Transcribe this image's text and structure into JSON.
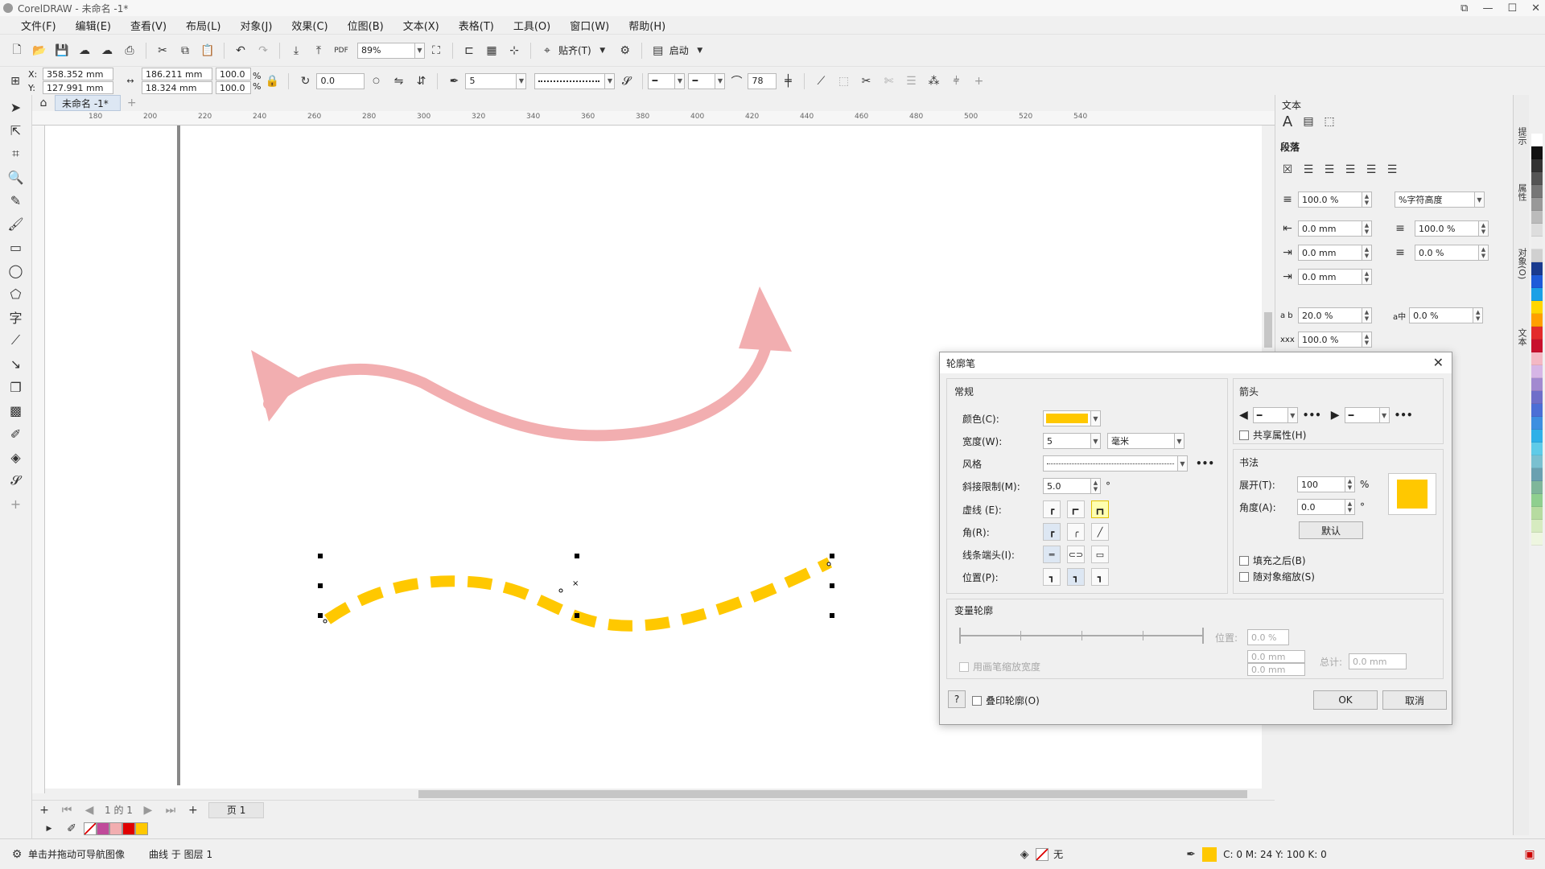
{
  "window": {
    "title": "CorelDRAW - 未命名 -1*"
  },
  "menu": [
    "文件(F)",
    "编辑(E)",
    "查看(V)",
    "布局(L)",
    "对象(J)",
    "效果(C)",
    "位图(B)",
    "文本(X)",
    "表格(T)",
    "工具(O)",
    "窗口(W)",
    "帮助(H)"
  ],
  "toolbar1": {
    "zoom": "89%",
    "snap_label": "贴齐(T)",
    "launch_label": "启动"
  },
  "toolbar2": {
    "x_label": "X:",
    "x_value": "358.352 mm",
    "y_label": "Y:",
    "y_value": "127.991 mm",
    "w_value": "186.211 mm",
    "h_value": "18.324 mm",
    "scale_w": "100.0",
    "scale_h": "100.0",
    "pct": "%",
    "rotation": "0.0",
    "outline_width": "5",
    "smooth": "78"
  },
  "doc_tab": "未命名 -1*",
  "ruler_labels": [
    "180",
    "200",
    "220",
    "240",
    "260",
    "280",
    "300",
    "320",
    "340",
    "360",
    "380",
    "400",
    "420",
    "440",
    "460",
    "480",
    "500",
    "520",
    "540"
  ],
  "pagebar": {
    "page_count": "1 的 1",
    "page_tab": "页 1"
  },
  "status": {
    "hint": "单击并拖动可导航图像",
    "layer": "曲线 于 图层 1",
    "fill_label": "无",
    "cmyk": "C: 0 M: 24 Y: 100 K: 0"
  },
  "docker": {
    "title": "文本",
    "section": "段落",
    "indent_pct": "100.0 %",
    "unit_select": "%字符高度",
    "left_indent": "0.0 mm",
    "first_indent": "0.0 mm",
    "right_indent": "0.0 mm",
    "before_pct": "100.0 %",
    "after_pct": "0.0 %",
    "char_spacing": "20.0 %",
    "lang_spacing": "0.0 %",
    "word_spacing": "100.0 %",
    "side_tabs": [
      "提示",
      "属性",
      "对象(O)",
      "文本"
    ]
  },
  "dialog": {
    "title": "轮廓笔",
    "general": "常规",
    "color_label": "颜色(C):",
    "width_label": "宽度(W):",
    "width_value": "5",
    "unit": "毫米",
    "style_label": "风格",
    "miter_label": "斜接限制(M):",
    "miter_value": "5.0",
    "degree": "°",
    "dash_label": "虚线 (E):",
    "corner_label": "角(R):",
    "cap_label": "线条端头(I):",
    "position_label": "位置(P):",
    "arrows": "箭头",
    "share_attr": "共享属性(H)",
    "calligraphy": "书法",
    "stretch_label": "展开(T):",
    "stretch_value": "100",
    "stretch_unit": "%",
    "angle_label": "角度(A):",
    "angle_value": "0.0",
    "angle_unit": "°",
    "default_btn": "默认",
    "fill_behind": "填充之后(B)",
    "scale_with": "随对象缩放(S)",
    "variable": "变量轮廓",
    "var_position_label": "位置:",
    "var_position": "0.0 %",
    "var_w1": "0.0 mm",
    "var_w2": "0.0 mm",
    "var_total_label": "总计:",
    "var_total": "0.0 mm",
    "var_scale_check": "用画笔缩放宽度",
    "help_btn": "?",
    "overprint": "叠印轮廓(O)",
    "ok": "OK",
    "cancel": "取消"
  },
  "colors": {
    "accent_yellow": "#FFC800",
    "arrow_pink": "#F2AEB0",
    "selection_blue": "#2E6BC6"
  },
  "palette_colors": [
    "#ffffff",
    "#111111",
    "#333333",
    "#555555",
    "#777777",
    "#999999",
    "#bbbbbb",
    "#dddddd",
    "#eeeeee",
    "#d0d0d0",
    "#1a3b8f",
    "#1e5bd9",
    "#1aa0e6",
    "#ffd600",
    "#ff9f00",
    "#e32b2b",
    "#c8102e",
    "#f4b8c4",
    "#d6b6e6",
    "#a28ad0",
    "#6f6fc9",
    "#4b6fd6",
    "#3d8fe0",
    "#2fb0e8",
    "#5fcbe8",
    "#7ac0d0",
    "#6aa0b0",
    "#7fb69a",
    "#8fcf8f",
    "#b6dba0",
    "#d6ebc0",
    "#eef6e0"
  ]
}
